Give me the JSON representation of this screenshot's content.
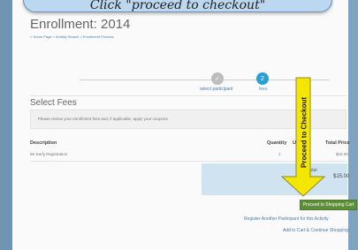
{
  "callout": {
    "text": "Click \"proceed to checkout\""
  },
  "page": {
    "title": "Enrollment: 2014",
    "breadcrumb": "< Home Page > Activity Search > Enrollment Process"
  },
  "steps": [
    {
      "label": "select participant",
      "icon": "check-icon",
      "state": "done"
    },
    {
      "label": "fees",
      "icon": "2",
      "state": "active"
    }
  ],
  "fees": {
    "section_title": "Select Fees",
    "info": "Please review your enrollment fees and, if applicable, apply your coupons.",
    "columns": [
      "Description",
      "Quantity",
      "Unit",
      "Total Price"
    ],
    "rows": [
      {
        "description": "5K Early Registration",
        "quantity": "1",
        "unit": "$",
        "total": "$15.00"
      }
    ],
    "total_label": "Total",
    "total_value": "$15.00"
  },
  "actions": {
    "proceed": "Proceed to Shopping Cart",
    "register_another": "Register Another Participant for this Activity",
    "add_to_cart": "Add to Cart & Continue Shopping"
  },
  "annotation": {
    "arrow_label": "Proceed to Checkout",
    "arrow_color": "#f5e600"
  }
}
